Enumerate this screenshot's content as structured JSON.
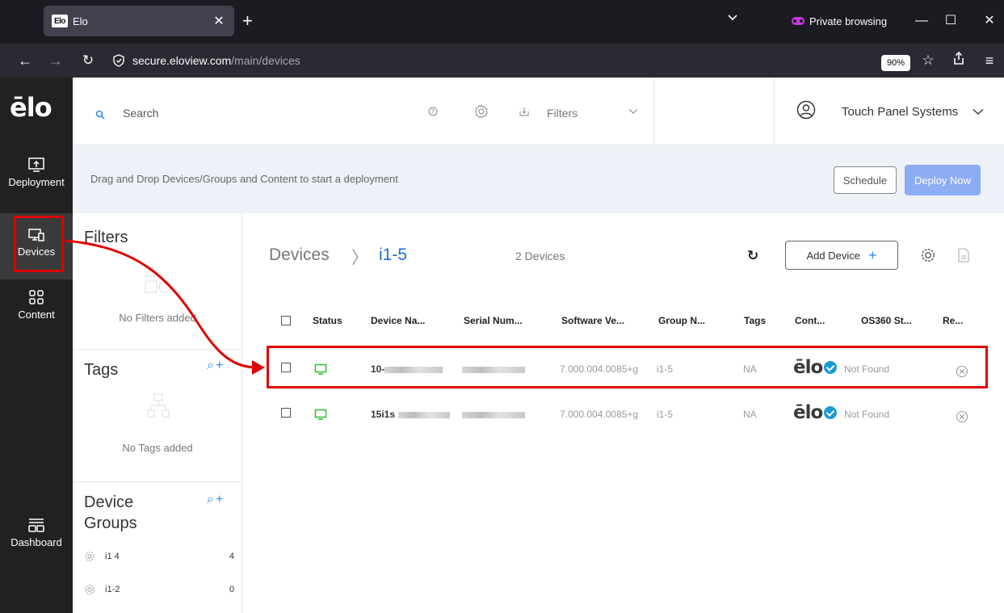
{
  "browser": {
    "tab_title": "Elo",
    "tab_favicon": "Elo",
    "private_label": "Private browsing",
    "url_host": "secure.eloview.com",
    "url_path": "/main/devices",
    "zoom": "90%"
  },
  "sidenav": {
    "logo": "ēlo",
    "items": [
      {
        "label": "Deployment"
      },
      {
        "label": "Devices"
      },
      {
        "label": "Content"
      },
      {
        "label": "Dashboard"
      }
    ]
  },
  "header": {
    "search_label": "Search",
    "filters_label": "Filters",
    "org_name": "Touch Panel Systems"
  },
  "banner": {
    "text": "Drag and Drop Devices/Groups and Content to start a deployment",
    "schedule_label": "Schedule",
    "deploy_label": "Deploy Now"
  },
  "left_panel": {
    "filters_title": "Filters",
    "filters_empty": "No Filters added",
    "tags_title": "Tags",
    "tags_empty": "No Tags added",
    "groups_title_1": "Device",
    "groups_title_2": "Groups",
    "groups": [
      {
        "name": "i1 4",
        "count": "4"
      },
      {
        "name": "i1-2",
        "count": "0"
      }
    ]
  },
  "main": {
    "crumb_root": "Devices",
    "crumb_sep": "〉",
    "crumb_leaf": "i1-5",
    "device_count": "2 Devices",
    "add_device_label": "Add Device",
    "columns": [
      "Status",
      "Device Na...",
      "Serial Num...",
      "Software Ve...",
      "Group N...",
      "Tags",
      "Cont...",
      "OS360 St...",
      "Re..."
    ],
    "rows": [
      {
        "device_name": "10-",
        "software": "7.000.004.0085+g",
        "group": "i1-5",
        "tags": "NA",
        "os360": "Not Found"
      },
      {
        "device_name": "15i1s",
        "software": "7.000.004.0085+g",
        "group": "i1-5",
        "tags": "NA",
        "os360": "Not Found"
      }
    ],
    "elo_word": "ēlo"
  },
  "colors": {
    "accent": "#2c8ef8",
    "highlight_red": "#e00000",
    "status_green": "#35c23a",
    "deploy_blue": "#8cadf4",
    "sidenav_bg": "#212121"
  }
}
